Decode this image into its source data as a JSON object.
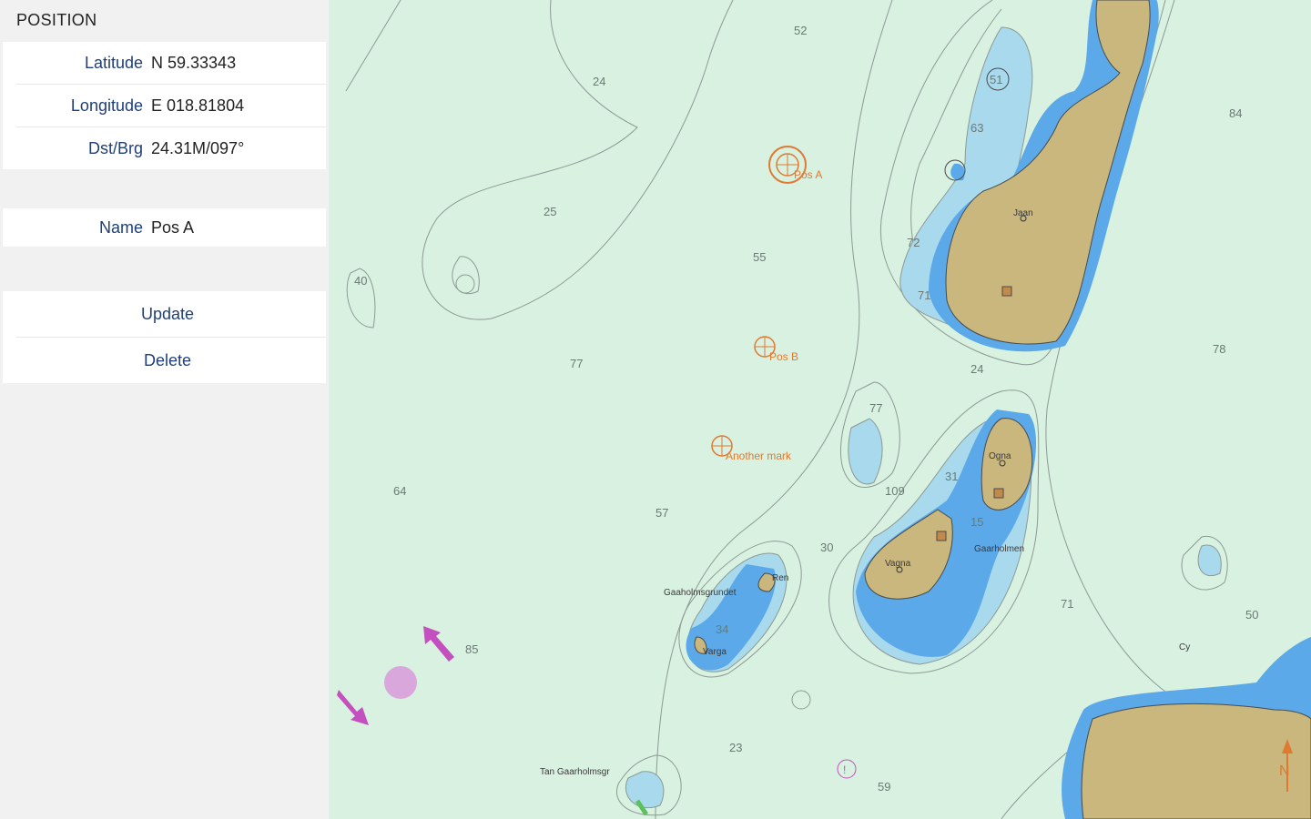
{
  "panel": {
    "title": "POSITION",
    "latitude_label": "Latitude",
    "latitude_value": "N 59.33343",
    "longitude_label": "Longitude",
    "longitude_value": "E 018.81804",
    "dstbrg_label": "Dst/Brg",
    "dstbrg_value": "24.31M/097°",
    "name_label": "Name",
    "name_value": "Pos A",
    "update_label": "Update",
    "delete_label": "Delete"
  },
  "map": {
    "waypoints": [
      "Pos A",
      "Pos B",
      "Another mark"
    ],
    "depths": [
      "52",
      "24",
      "25",
      "55",
      "77",
      "64",
      "57",
      "85",
      "30",
      "23",
      "59",
      "78",
      "71",
      "24",
      "84",
      "50",
      "40",
      "63",
      "51",
      "72",
      "71",
      "77",
      "109",
      "31",
      "15",
      "34"
    ],
    "places": [
      "Jaan",
      "Ogna",
      "Vagna",
      "Gaaholmsgrundet",
      "Ren",
      "Varga",
      "Gaarholmen",
      "Tan Gaarholmsgr",
      "Cy"
    ],
    "north_label": "N",
    "colors": {
      "sea": "#d8f1e1",
      "shallow": "#a9d9ec",
      "deep_shallow": "#5ba9e8",
      "land": "#c9b77e",
      "waypoint": "#e07a30",
      "pan": "#c44fbf"
    }
  }
}
